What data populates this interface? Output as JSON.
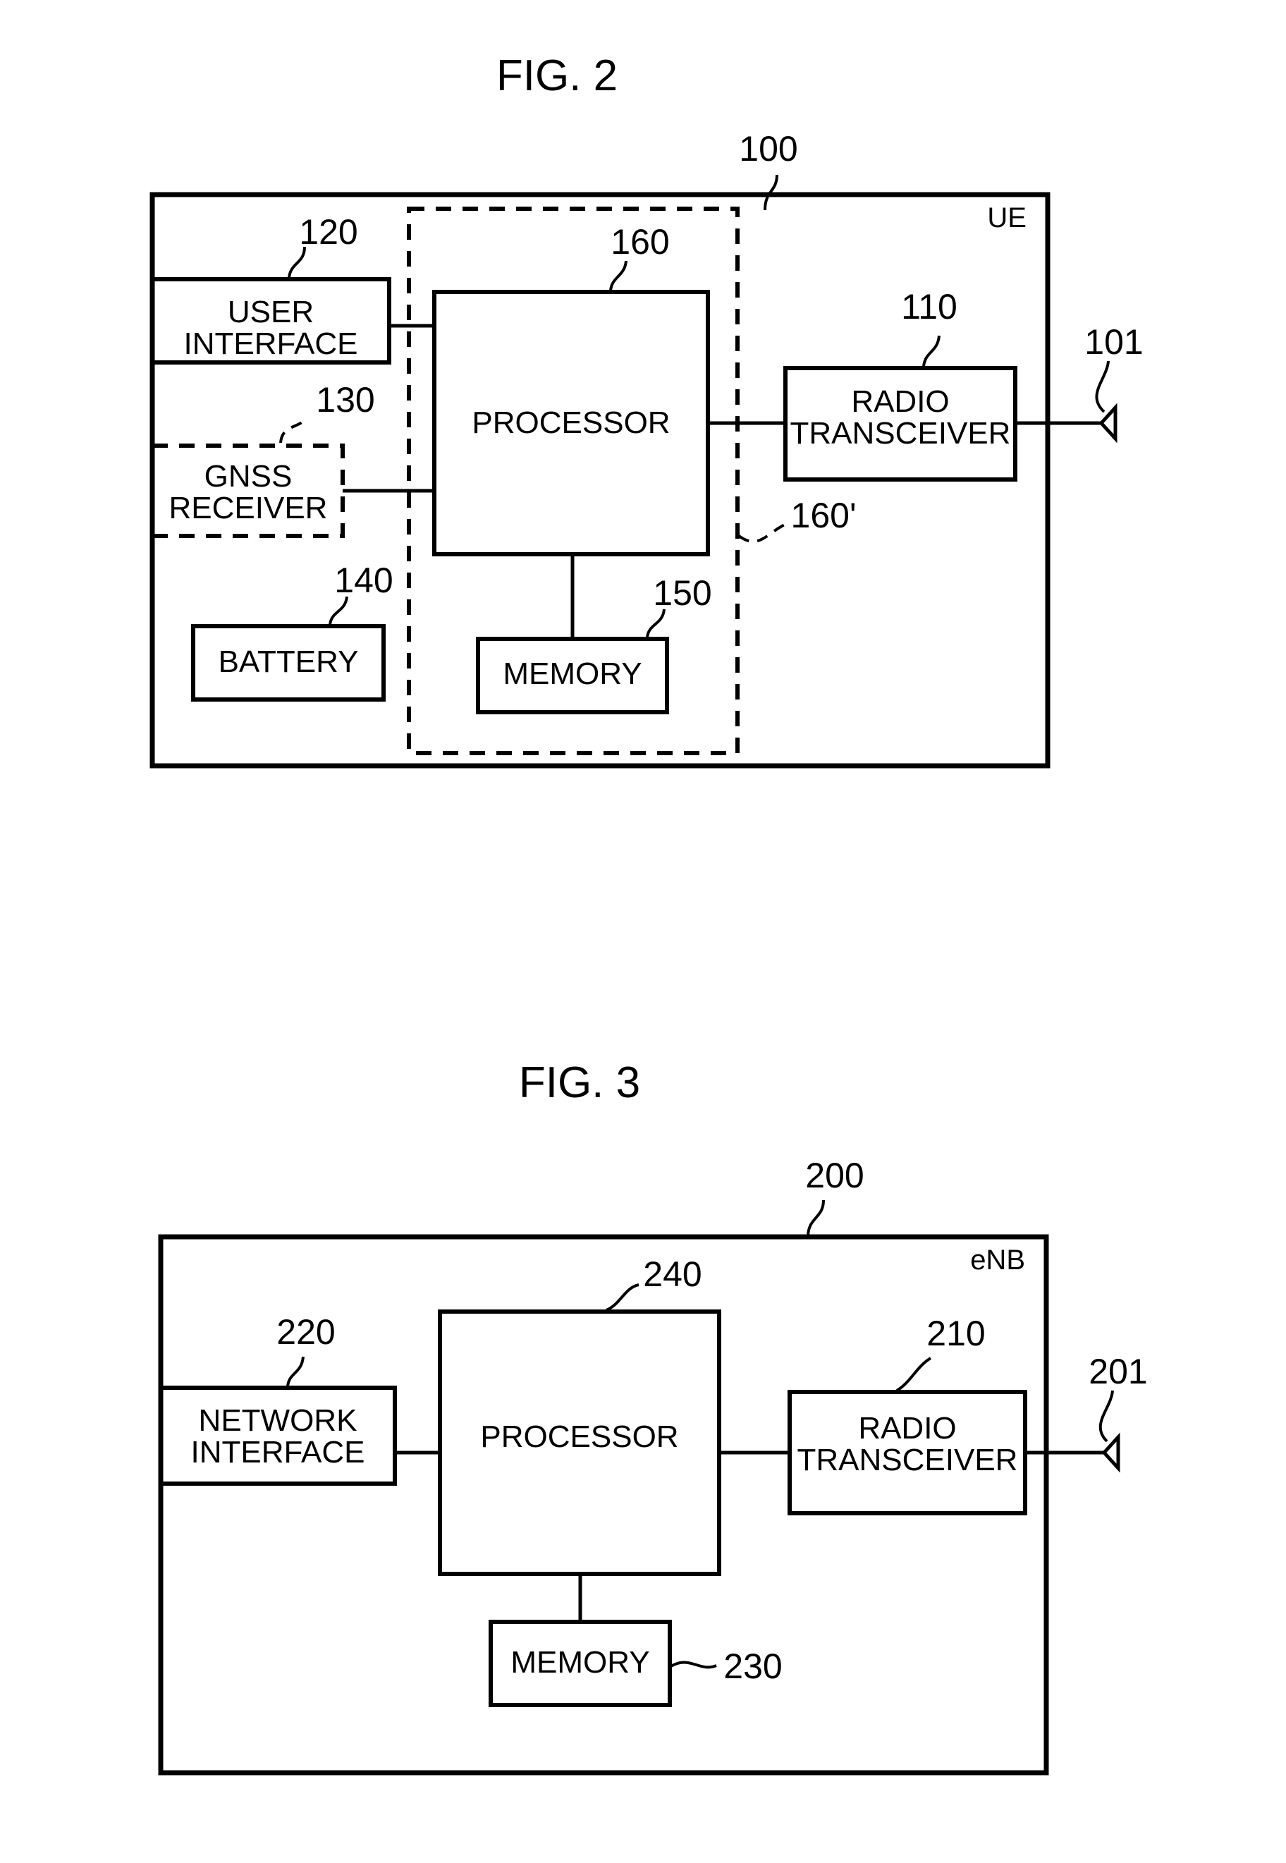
{
  "page": {
    "background_color": "#ffffff",
    "line_color": "#000000"
  },
  "figures": [
    {
      "id": "fig-2",
      "title": "FIG. 2",
      "device_ref": "100",
      "corner_label": "UE",
      "antenna_ref": "101",
      "blocks": [
        {
          "key": "user_interface",
          "label_line1": "USER",
          "label_line2": "INTERFACE",
          "ref": "120",
          "style": "solid"
        },
        {
          "key": "gnss_receiver",
          "label_line1": "GNSS",
          "label_line2": "RECEIVER",
          "ref": "130",
          "style": "dashed"
        },
        {
          "key": "battery",
          "label_line1": "BATTERY",
          "label_line2": "",
          "ref": "140",
          "style": "solid"
        },
        {
          "key": "processor",
          "label_line1": "PROCESSOR",
          "label_line2": "",
          "ref": "160",
          "style": "solid"
        },
        {
          "key": "memory",
          "label_line1": "MEMORY",
          "label_line2": "",
          "ref": "150",
          "style": "solid"
        },
        {
          "key": "radio_transceiver",
          "label_line1": "RADIO",
          "label_line2": "TRANSCEIVER",
          "ref": "110",
          "style": "solid"
        },
        {
          "key": "processing_group",
          "label_line1": "",
          "label_line2": "",
          "ref": "160'",
          "style": "dashed"
        }
      ]
    },
    {
      "id": "fig-3",
      "title": "FIG. 3",
      "device_ref": "200",
      "corner_label": "eNB",
      "antenna_ref": "201",
      "blocks": [
        {
          "key": "network_interface",
          "label_line1": "NETWORK",
          "label_line2": "INTERFACE",
          "ref": "220",
          "style": "solid"
        },
        {
          "key": "processor",
          "label_line1": "PROCESSOR",
          "label_line2": "",
          "ref": "240",
          "style": "solid"
        },
        {
          "key": "memory",
          "label_line1": "MEMORY",
          "label_line2": "",
          "ref": "230",
          "style": "solid"
        },
        {
          "key": "radio_transceiver",
          "label_line1": "RADIO",
          "label_line2": "TRANSCEIVER",
          "ref": "210",
          "style": "solid"
        }
      ]
    }
  ]
}
